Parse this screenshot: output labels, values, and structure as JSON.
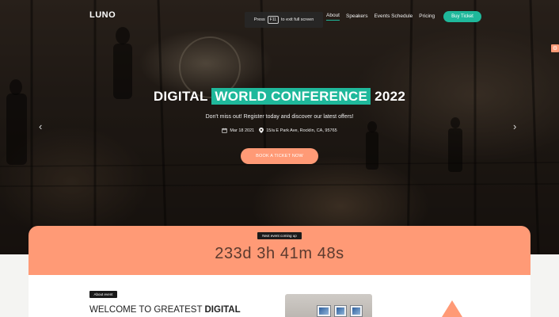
{
  "brand": {
    "logo": "LUNO"
  },
  "fullscreen_tip": {
    "prefix": "Press",
    "key": "F11",
    "suffix": "to exit full screen"
  },
  "nav": {
    "items": [
      {
        "label": "About",
        "active": true
      },
      {
        "label": "Speakers"
      },
      {
        "label": "Events Schedule"
      },
      {
        "label": "Pricing"
      }
    ],
    "buy_label": "Buy Ticket"
  },
  "hero": {
    "title_pre": "DIGITAL",
    "title_highlight": "WORLD CONFERENCE",
    "title_post": "2022",
    "tagline": "Don't miss out! Register today and discover our latest offers!",
    "date": "Mar 18 2021",
    "location": "15/a E Park Ave, Rocklin, CA, 95765",
    "cta_label": "BOOK A TICKET NOW",
    "prev_glyph": "‹",
    "next_glyph": "›"
  },
  "countdown": {
    "badge": "Next event coming up",
    "time": "233d 3h 41m 48s"
  },
  "about": {
    "badge": "About event",
    "title_pre": "WELCOME TO GREATEST",
    "title_bold": "DIGITAL"
  },
  "colors": {
    "accent": "#1fb89b",
    "orange": "#ff9a76"
  },
  "icons": {
    "settings": "gear-icon",
    "date": "calendar-icon",
    "location": "map-pin-icon"
  }
}
